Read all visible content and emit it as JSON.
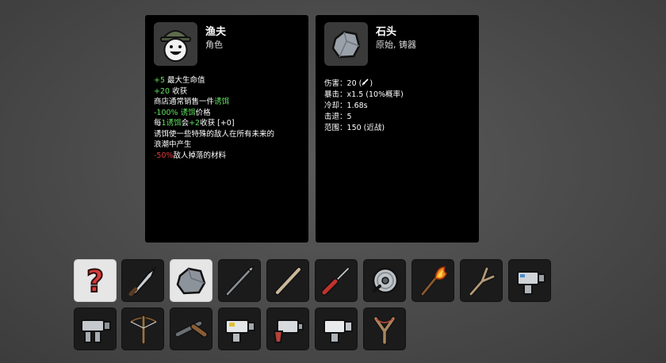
{
  "character": {
    "name": "渔夫",
    "type": "角色",
    "icon": "fisherman-portrait",
    "effects": [
      [
        {
          "t": "+5",
          "c": "g"
        },
        {
          "t": " 最大生命值",
          "c": "w"
        }
      ],
      [
        {
          "t": "+20",
          "c": "g"
        },
        {
          "t": " 收获",
          "c": "w"
        }
      ],
      [
        {
          "t": "商店通常销售一件",
          "c": "w"
        },
        {
          "t": "诱饵",
          "c": "g"
        }
      ],
      [
        {
          "t": "-100%",
          "c": "g"
        },
        {
          "t": " 诱饵",
          "c": "g"
        },
        {
          "t": "价格",
          "c": "w"
        }
      ],
      [
        {
          "t": "每",
          "c": "w"
        },
        {
          "t": "1",
          "c": "g"
        },
        {
          "t": "诱饵",
          "c": "g"
        },
        {
          "t": "会",
          "c": "w"
        },
        {
          "t": "+2",
          "c": "g"
        },
        {
          "t": "收获 [+0]",
          "c": "w"
        }
      ],
      [
        {
          "t": "诱饵使一些特殊的敌人在所有未来的",
          "c": "w"
        }
      ],
      [
        {
          "t": "浪潮中产生",
          "c": "w"
        }
      ],
      [
        {
          "t": "-50%",
          "c": "r"
        },
        {
          "t": "敌人掉落的材料",
          "c": "w"
        }
      ]
    ]
  },
  "weapon": {
    "name": "石头",
    "type": "原始, 铸器",
    "icon": "rock-icon",
    "stats": [
      {
        "label": "伤害",
        "value": "20 (",
        "extra": ")"
      },
      {
        "label": "暴击",
        "value": "x1.5 (10%概率)"
      },
      {
        "label": "冷却",
        "value": "1.68s"
      },
      {
        "label": "击退",
        "value": "5"
      },
      {
        "label": "范围",
        "value": "150 (近战)"
      }
    ]
  },
  "inventory": {
    "row1": [
      "question-mark-icon",
      "knife-icon",
      "rock-icon",
      "spear-icon",
      "stick-icon",
      "screwdriver-icon",
      "shield-icon",
      "torch-icon",
      "slingshot-branch-icon",
      "turret-icon"
    ],
    "row2": [
      "turret-icon",
      "crossbow-icon",
      "shotgun-icon",
      "turret-icon",
      "gun-turret-icon",
      "turret-icon",
      "slingshot-icon"
    ],
    "selected_index": 2
  }
}
